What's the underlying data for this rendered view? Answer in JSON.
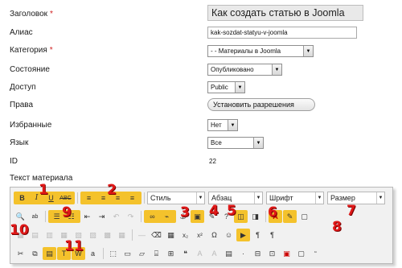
{
  "form": {
    "rows": [
      {
        "label": "Заголовок",
        "required": true
      },
      {
        "label": "Алиас",
        "required": false
      },
      {
        "label": "Категория",
        "required": true
      },
      {
        "label": "Состояние",
        "required": false
      },
      {
        "label": "Доступ",
        "required": false
      },
      {
        "label": "Права",
        "required": false
      },
      {
        "label": "Избранные",
        "required": false
      },
      {
        "label": "Язык",
        "required": false
      },
      {
        "label": "ID",
        "required": false
      },
      {
        "label": "Текст материала",
        "required": false
      }
    ],
    "required_marker": "*",
    "title_value": "Как создать статью в Joomla",
    "alias_value": "kak-sozdat-statyu-v-joomla",
    "category_value": "- - Материалы в Joomla",
    "state_value": "Опубликовано",
    "access_value": "Public",
    "permissions_button": "Установить разрешения",
    "featured_value": "Нет",
    "language_value": "Все",
    "id_value": "22"
  },
  "editor": {
    "dropdowns": {
      "style": "Стиль",
      "paragraph": "Абзац",
      "font": "Шрифт",
      "size": "Размер"
    },
    "buttons": {
      "bold": "B",
      "italic": "I",
      "underline": "U",
      "strike": "ABC"
    },
    "callouts": [
      "1",
      "2",
      "3",
      "4",
      "5",
      "6",
      "7",
      "8",
      "9",
      "10",
      "11"
    ]
  },
  "colors": {
    "highlight": "#f4c22c",
    "callout": "#e01818",
    "required": "#d02020"
  }
}
